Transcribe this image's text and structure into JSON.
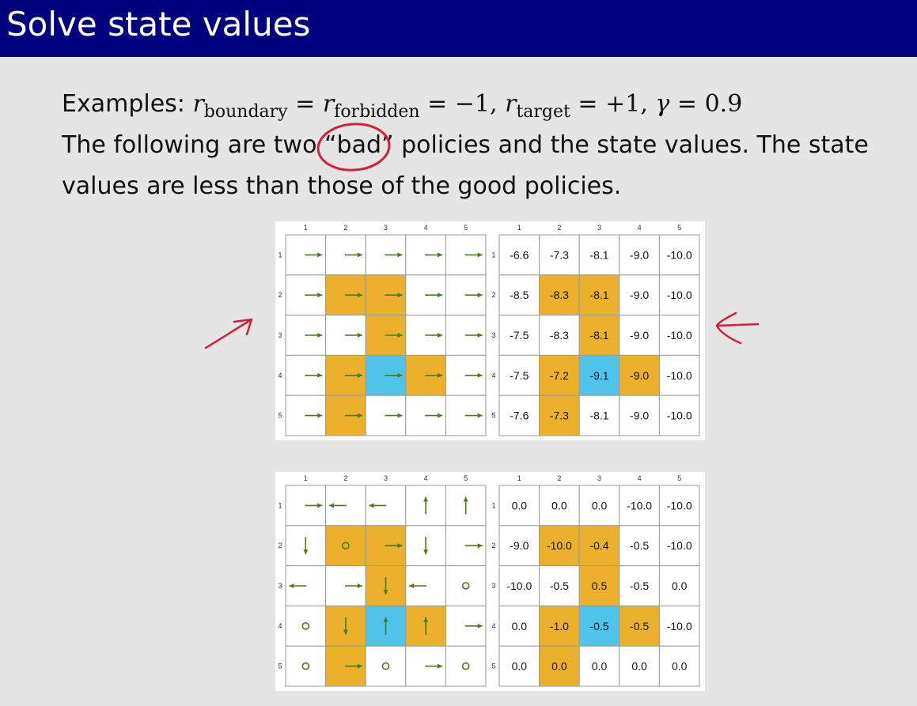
{
  "slide": {
    "title": "Solve state values",
    "examples_prefix": "Examples: ",
    "math": {
      "r": "r",
      "sub_boundary": "boundary",
      "sub_forbidden": "forbidden",
      "sub_target": "target",
      "eq": " = ",
      "minus_one": "−1",
      "plus_one": "+1",
      "gamma": "γ",
      "gamma_value": "0.9",
      "comma": ", "
    },
    "line2_a": "The following are two ",
    "line2_bad": "“bad”",
    "line2_b": " policies and the state values.  The state",
    "line3": "values are less than those of the good policies."
  },
  "colors": {
    "header_bg": "#00007e",
    "forbidden": "#ebb12b",
    "target": "#4fc3ea",
    "arrow": "#4a7a1a",
    "annotation": "#d4213a"
  },
  "axis_labels": [
    "1",
    "2",
    "3",
    "4",
    "5"
  ],
  "grids": [
    {
      "cells": [
        [
          "w",
          "w",
          "w",
          "w",
          "w"
        ],
        [
          "w",
          "f",
          "f",
          "w",
          "w"
        ],
        [
          "w",
          "w",
          "f",
          "w",
          "w"
        ],
        [
          "w",
          "f",
          "t",
          "f",
          "w"
        ],
        [
          "w",
          "f",
          "w",
          "w",
          "w"
        ]
      ],
      "policy": [
        [
          "right",
          "right",
          "right",
          "right",
          "right"
        ],
        [
          "right",
          "right",
          "right",
          "right",
          "right"
        ],
        [
          "right",
          "right",
          "right",
          "right",
          "right"
        ],
        [
          "right",
          "right",
          "right",
          "right",
          "right"
        ],
        [
          "right",
          "right",
          "right",
          "right",
          "right"
        ]
      ],
      "values": [
        [
          "-6.6",
          "-7.3",
          "-8.1",
          "-9.0",
          "-10.0"
        ],
        [
          "-8.5",
          "-8.3",
          "-8.1",
          "-9.0",
          "-10.0"
        ],
        [
          "-7.5",
          "-8.3",
          "-8.1",
          "-9.0",
          "-10.0"
        ],
        [
          "-7.5",
          "-7.2",
          "-9.1",
          "-9.0",
          "-10.0"
        ],
        [
          "-7.6",
          "-7.3",
          "-8.1",
          "-9.0",
          "-10.0"
        ]
      ]
    },
    {
      "cells": [
        [
          "w",
          "w",
          "w",
          "w",
          "w"
        ],
        [
          "w",
          "f",
          "f",
          "w",
          "w"
        ],
        [
          "w",
          "w",
          "f",
          "w",
          "w"
        ],
        [
          "w",
          "f",
          "t",
          "f",
          "w"
        ],
        [
          "w",
          "f",
          "w",
          "w",
          "w"
        ]
      ],
      "policy": [
        [
          "right",
          "left",
          "left",
          "up",
          "up"
        ],
        [
          "down",
          "stay",
          "right",
          "down",
          "right"
        ],
        [
          "left",
          "right",
          "down",
          "left",
          "stay"
        ],
        [
          "stay",
          "down",
          "up",
          "up",
          "right"
        ],
        [
          "stay",
          "right",
          "stay",
          "right",
          "stay"
        ]
      ],
      "values": [
        [
          "0.0",
          "0.0",
          "0.0",
          "-10.0",
          "-10.0"
        ],
        [
          "-9.0",
          "-10.0",
          "-0.4",
          "-0.5",
          "-10.0"
        ],
        [
          "-10.0",
          "-0.5",
          "0.5",
          "-0.5",
          "0.0"
        ],
        [
          "0.0",
          "-1.0",
          "-0.5",
          "-0.5",
          "-10.0"
        ],
        [
          "0.0",
          "0.0",
          "0.0",
          "0.0",
          "0.0"
        ]
      ]
    }
  ]
}
